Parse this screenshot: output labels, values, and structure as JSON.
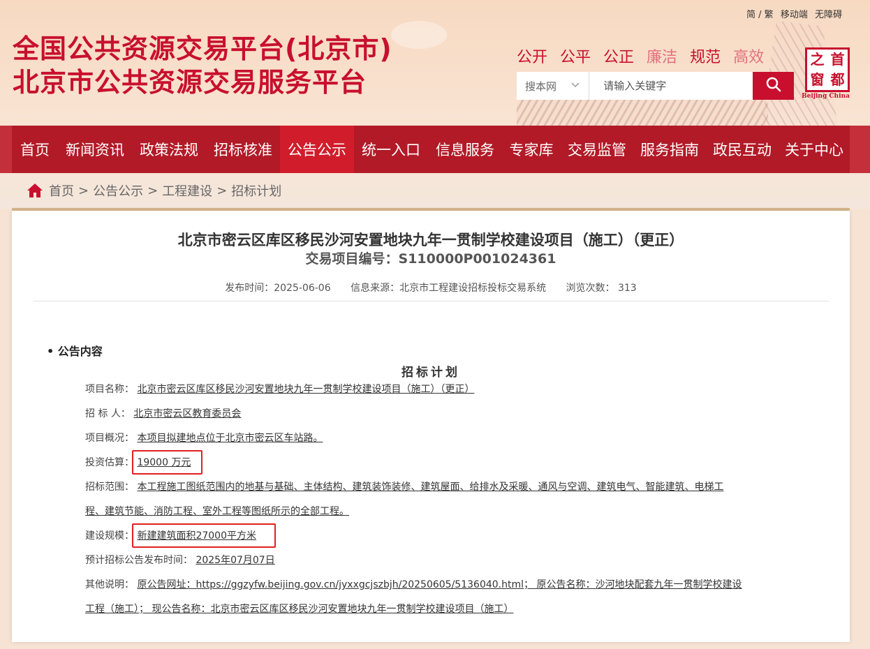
{
  "utility": {
    "simplified_traditional": "简 / 繁",
    "mobile": "移动端",
    "accessibility": "无障碍"
  },
  "site": {
    "title_line1": "全国公共资源交易平台(北京市)",
    "title_line2": "北京市公共资源交易服务平台"
  },
  "values": [
    "公开",
    "公平",
    "公正",
    "廉洁",
    "规范",
    "高效"
  ],
  "search": {
    "scope": "搜本网",
    "placeholder": "请输入关键字"
  },
  "logo": {
    "chars": [
      "之",
      "首",
      "窗",
      "都"
    ],
    "caption": "Beijing China"
  },
  "nav": [
    "首页",
    "新闻资讯",
    "政策法规",
    "招标核准",
    "公告公示",
    "统一入口",
    "信息服务",
    "专家库",
    "交易监管",
    "服务指南",
    "政民互动",
    "关于中心"
  ],
  "nav_active": "公告公示",
  "breadcrumb": {
    "home": "首页",
    "level1": "公告公示",
    "level2": "工程建设",
    "level3": "招标计划"
  },
  "article": {
    "title": "北京市密云区库区移民沙河安置地块九年一贯制学校建设项目（施工）（更正）",
    "code": "交易项目编号：S110000P001024361",
    "publish_time": "发布时间：2025-06-06",
    "source": "信息来源：北京市工程建设招标投标交易系统",
    "views": "浏览次数：  313",
    "section": "• 公告内容",
    "doc_heading": "招标计划"
  },
  "fields": {
    "project_name_label": "项目名称：",
    "project_name": "北京市密云区库区移民沙河安置地块九年一贯制学校建设项目（施工）（更正）",
    "tenderer_label": "招 标 人：",
    "tenderer": "北京市密云区教育委员会",
    "overview_label": "项目概况：",
    "overview": "本项目拟建地点位于北京市密云区车站路。",
    "investment_label": "投资估算：",
    "investment": "19000 万元",
    "scope_label": "招标范围：",
    "scope_line1": "本工程施工图纸范围内的地基与基础、主体结构、建筑装饰装修、建筑屋面、给排水及采暖、通风与空调、建筑电气、智能建筑、电梯工",
    "scope_line2": "程、建筑节能、消防工程、室外工程等图纸所示的全部工程。",
    "scale_label": "建设规模：",
    "scale": "新建建筑面积27000平方米",
    "expected_label": "预计招标公告发布时间：",
    "expected": "2025年07月07日",
    "other_label": "其他说明：",
    "other_line1": "原公告网址：https://ggzyfw.beijing.gov.cn/jyxxgcjszbjh/20250605/5136040.html；  原公告名称：沙河地块配套九年一贯制学校建设",
    "other_line2": "工程（施工）；  现公告名称：北京市密云区库区移民沙河安置地块九年一贯制学校建设项目（施工）"
  }
}
